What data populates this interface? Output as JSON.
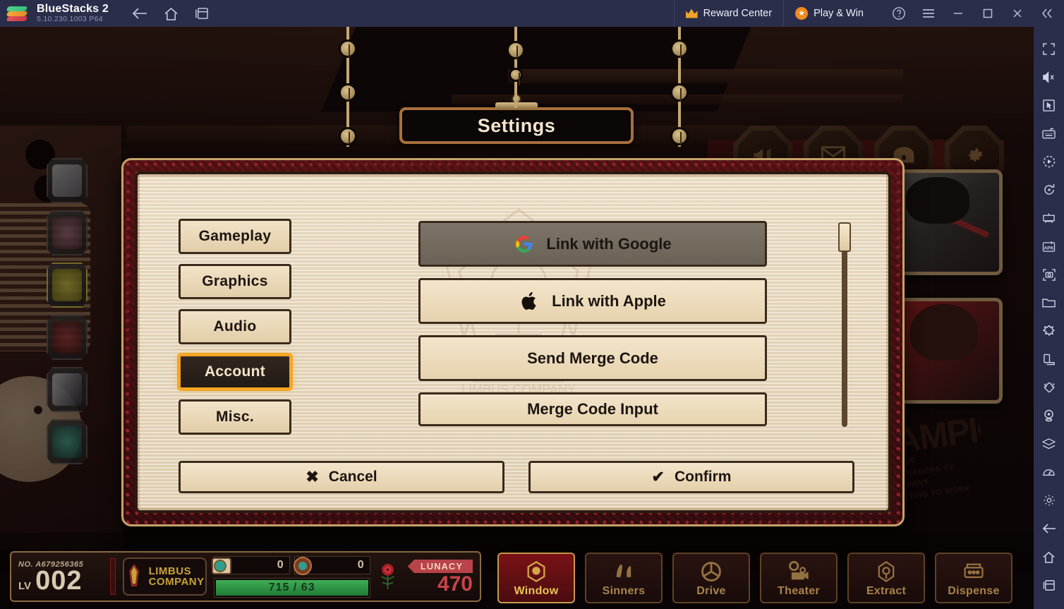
{
  "titlebar": {
    "app_name": "BlueStacks 2",
    "version": "5.10.230.1003  P64",
    "nav": [
      {
        "name": "back",
        "label": "Back"
      },
      {
        "name": "home",
        "label": "Home"
      },
      {
        "name": "multi-instance",
        "label": "Multi-instance"
      }
    ],
    "reward_center": "Reward Center",
    "play_and_win": "Play & Win",
    "help": "?",
    "menu": "Menu",
    "minimize": "Minimize",
    "maximize": "Maximize",
    "close": "Close",
    "collapse": "Collapse sidebar"
  },
  "rail": {
    "items": [
      {
        "name": "fullscreen-icon",
        "label": "Fullscreen"
      },
      {
        "name": "mute-icon",
        "label": "Mute"
      },
      {
        "name": "pointer-icon",
        "label": "Controls"
      },
      {
        "name": "keyboard-icon",
        "label": "Keymapping"
      },
      {
        "name": "macro-play-icon",
        "label": "Macro"
      },
      {
        "name": "rotate-icon",
        "label": "Rotate"
      },
      {
        "name": "multi-instance-manager-icon",
        "label": "Instance Manager"
      },
      {
        "name": "install-apk-icon",
        "label": "Install APK"
      },
      {
        "name": "screenshot-icon",
        "label": "Screenshot"
      },
      {
        "name": "media-folder-icon",
        "label": "Media Manager"
      },
      {
        "name": "eco-mode-icon",
        "label": "Eco Mode"
      },
      {
        "name": "device-profile-icon",
        "label": "Device Profile"
      },
      {
        "name": "shake-icon",
        "label": "Shake"
      },
      {
        "name": "location-icon",
        "label": "Location"
      },
      {
        "name": "layers-icon",
        "label": "Layers"
      },
      {
        "name": "performance-icon",
        "label": "Performance"
      },
      {
        "name": "settings-gear-icon",
        "label": "Settings"
      },
      {
        "name": "back-icon",
        "label": "Back"
      },
      {
        "name": "home-icon",
        "label": "Home"
      },
      {
        "name": "recents-icon",
        "label": "Recent apps"
      }
    ]
  },
  "dialog": {
    "title": "Settings",
    "tabs": [
      {
        "label": "Gameplay",
        "name": "gameplay",
        "active": false
      },
      {
        "label": "Graphics",
        "name": "graphics",
        "active": false
      },
      {
        "label": "Audio",
        "name": "audio",
        "active": false
      },
      {
        "label": "Account",
        "name": "account",
        "active": true
      },
      {
        "label": "Misc.",
        "name": "misc",
        "active": false
      }
    ],
    "options": [
      {
        "label": "Link with Google",
        "icon": "google-icon",
        "hovered": true
      },
      {
        "label": "Link with Apple",
        "icon": "apple-icon",
        "hovered": false
      },
      {
        "label": "Send Merge Code",
        "icon": "none",
        "hovered": false
      },
      {
        "label": "Merge Code Input",
        "icon": "none",
        "hovered": false
      }
    ],
    "footer": {
      "cancel": "Cancel",
      "cancel_mark": "✖",
      "confirm": "Confirm",
      "confirm_mark": "✔"
    },
    "scroll_position": "top"
  },
  "game_hud": {
    "player_id_prefix": "NO.",
    "player_id": "A679256365",
    "level_label": "LV",
    "level_value": "002",
    "guild_line1": "LIMBUS",
    "guild_line2": "COMPANY",
    "currency": [
      {
        "name": "ticket",
        "value": "0"
      },
      {
        "name": "module",
        "value": "0"
      }
    ],
    "energy": "715 / 63",
    "lunacy_label": "LUNACY",
    "lunacy_value": "470",
    "nav": [
      {
        "label": "Window",
        "name": "window",
        "active": true
      },
      {
        "label": "Sinners",
        "name": "sinners",
        "active": false
      },
      {
        "label": "Drive",
        "name": "drive",
        "active": false
      },
      {
        "label": "Theater",
        "name": "theater",
        "active": false
      },
      {
        "label": "Extract",
        "name": "extract",
        "active": false
      },
      {
        "label": "Dispense",
        "name": "dispense",
        "active": false
      }
    ]
  },
  "game_top_icons": [
    {
      "name": "announcement-icon",
      "label": "Announcements"
    },
    {
      "name": "mail-icon",
      "label": "Mail"
    },
    {
      "name": "chest-icon",
      "label": "Rewards"
    },
    {
      "name": "gear-icon",
      "label": "Settings"
    }
  ],
  "poster": {
    "heading": "CHAMPIONS",
    "line1": "A HANDY GUIDE",
    "line2": "FOR NEW MANAGERS OF LIMBUS COMPANY",
    "line3": "BEFORE GETTING TO WORK"
  },
  "colors": {
    "titlebar_bg": "#2a2e4b",
    "accent_orange": "#f5a623",
    "panel_cream": "#efe2cb",
    "frame_gold": "#c7a36a",
    "dialog_red": "#5b1316",
    "lunacy_red": "#c8434a",
    "energy_green": "#3fae54"
  }
}
